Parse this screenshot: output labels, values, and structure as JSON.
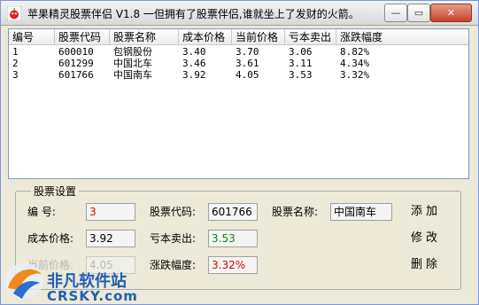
{
  "window": {
    "title": "苹果精灵股票伴侣 V1.8   一但拥有了股票伴侣,谁就坐上了发财的火箭。",
    "minimize_symbol": "—",
    "maximize_symbol": "▭",
    "close_symbol": "✕"
  },
  "list": {
    "columns": [
      "编号",
      "股票代码",
      "股票名称",
      "成本价格",
      "当前价格",
      "亏本卖出",
      "涨跌幅度"
    ],
    "rows": [
      [
        "1",
        "600010",
        "包钢股份",
        "3.40",
        "3.70",
        "3.06",
        "8.82%"
      ],
      [
        "2",
        "601299",
        "中国北车",
        "3.46",
        "3.61",
        "3.11",
        "4.34%"
      ],
      [
        "3",
        "601766",
        "中国南车",
        "3.92",
        "4.05",
        "3.53",
        "3.32%"
      ]
    ]
  },
  "settings": {
    "group_title": "股票设置",
    "id_label": "编    号:",
    "id_value": "3",
    "code_label": "股票代码:",
    "code_value": "601766",
    "name_label": "股票名称:",
    "name_value": "中国南车",
    "cost_label": "成本价格:",
    "cost_value": "3.92",
    "stoploss_label": "亏本卖出:",
    "stoploss_value": "3.53",
    "current_label": "当前价格:",
    "current_value": "4.05",
    "change_label": "涨跌幅度:",
    "change_value": "3.32%"
  },
  "actions": {
    "add": "添加",
    "edit": "修改",
    "delete": "删除"
  },
  "watermark": {
    "brand": "非凡软件站",
    "url": "CRSKY.com"
  },
  "colors": {
    "red_value": "#e00000",
    "green_value": "#108010"
  }
}
